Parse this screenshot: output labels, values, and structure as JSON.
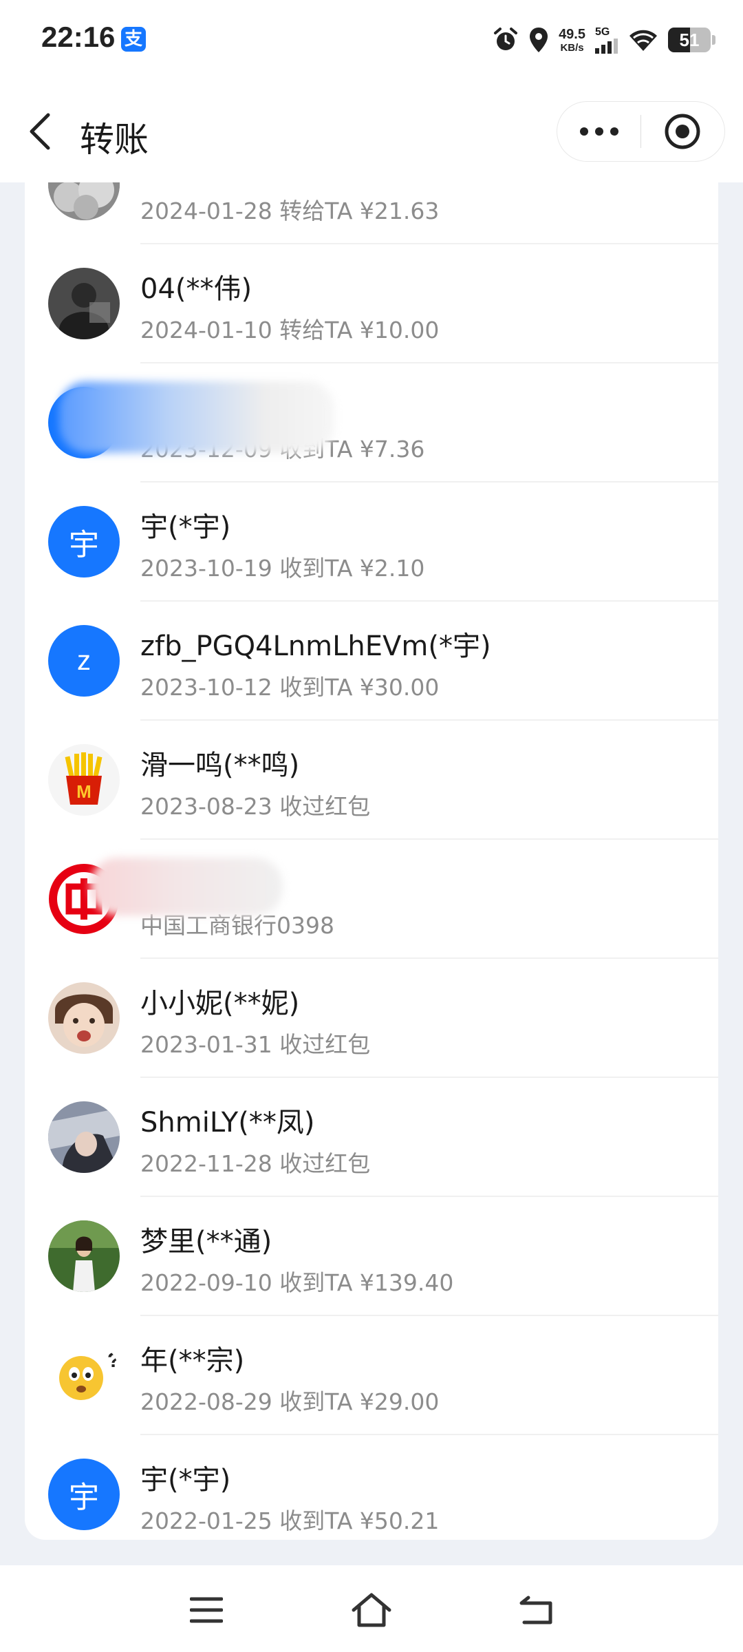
{
  "status": {
    "time": "22:16",
    "app_badge": "支",
    "net_speed": "49.5",
    "net_unit": "KB/s",
    "network": "5G",
    "battery": "51",
    "battery_level": 0.51
  },
  "header": {
    "title": "转账",
    "icons": {
      "back": "chevron-left-icon",
      "more": "more-dots-icon",
      "close": "target-circle-icon"
    }
  },
  "contacts": [
    {
      "name": "",
      "sub": "2024-01-28 转给TA ¥21.63",
      "avatar": "photo-gray"
    },
    {
      "name": "04(**伟)",
      "sub": "2024-01-10 转给TA ¥10.00",
      "avatar": "photo-dark"
    },
    {
      "name": "",
      "sub": "2023-12-09 收到TA ¥7.36",
      "avatar": "blurred-blue"
    },
    {
      "name": "宇(*宇)",
      "sub": "2023-10-19 收到TA ¥2.10",
      "avatar": "blue",
      "initial": "宇"
    },
    {
      "name": "zfb_PGQ4LnmLhEVm(*宇)",
      "sub": "2023-10-12 收到TA ¥30.00",
      "avatar": "blue",
      "initial": "z"
    },
    {
      "name": "滑一鸣(**鸣)",
      "sub": "2023-08-23 收过红包",
      "avatar": "fries"
    },
    {
      "name": "",
      "sub": "中国工商银行0398",
      "avatar": "icbc-logo"
    },
    {
      "name": "小小妮(**妮)",
      "sub": "2023-01-31 收过红包",
      "avatar": "photo-child"
    },
    {
      "name": "ShmiLY(**凤)",
      "sub": "2022-11-28 收过红包",
      "avatar": "photo-woman"
    },
    {
      "name": "梦里(**通)",
      "sub": "2022-09-10 收到TA ¥139.40",
      "avatar": "photo-field"
    },
    {
      "name": "年(**宗)",
      "sub": "2022-08-29 收到TA ¥29.00",
      "avatar": "emoji"
    },
    {
      "name": "宇(*宇)",
      "sub": "2022-01-25 收到TA ¥50.21",
      "avatar": "blue",
      "initial": "宇"
    }
  ],
  "colors": {
    "accent": "#1677ff",
    "background": "#eef1f6",
    "secondary_text": "#8c8c8c",
    "icbc_red": "#e60012"
  },
  "system_nav": {
    "icons": [
      "menu-icon",
      "home-icon",
      "back-icon"
    ]
  }
}
